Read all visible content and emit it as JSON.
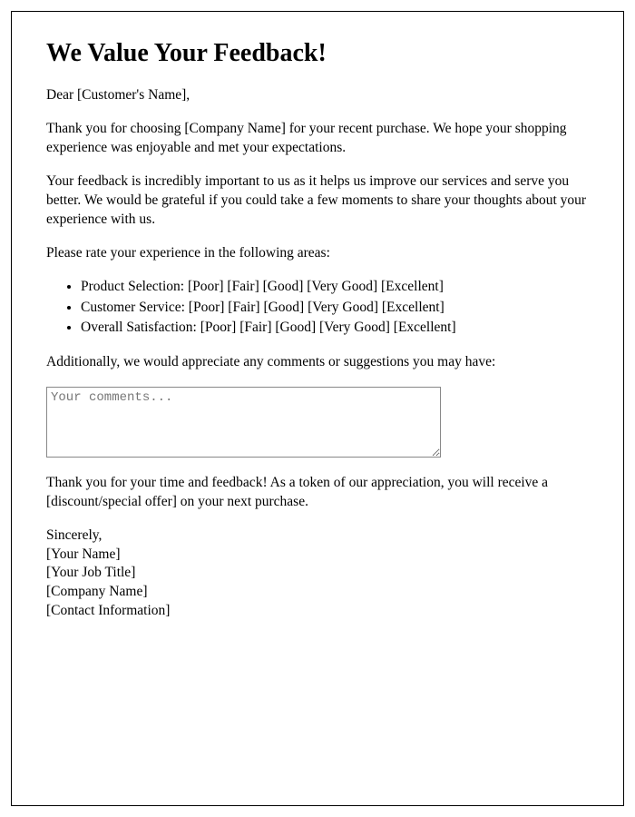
{
  "heading": "We Value Your Feedback!",
  "salutation": "Dear [Customer's Name],",
  "para1": "Thank you for choosing [Company Name] for your recent purchase. We hope your shopping experience was enjoyable and met your expectations.",
  "para2": "Your feedback is incredibly important to us as it helps us improve our services and serve you better. We would be grateful if you could take a few moments to share your thoughts about your experience with us.",
  "para3": "Please rate your experience in the following areas:",
  "ratings": [
    "Product Selection: [Poor] [Fair] [Good] [Very Good] [Excellent]",
    "Customer Service: [Poor] [Fair] [Good] [Very Good] [Excellent]",
    "Overall Satisfaction: [Poor] [Fair] [Good] [Very Good] [Excellent]"
  ],
  "para4": "Additionally, we would appreciate any comments or suggestions you may have:",
  "comments_placeholder": "Your comments...",
  "para5": "Thank you for your time and feedback! As a token of our appreciation, you will receive a [discount/special offer] on your next purchase.",
  "signature": {
    "closing": "Sincerely,",
    "name": "[Your Name]",
    "title": "[Your Job Title]",
    "company": "[Company Name]",
    "contact": "[Contact Information]"
  }
}
